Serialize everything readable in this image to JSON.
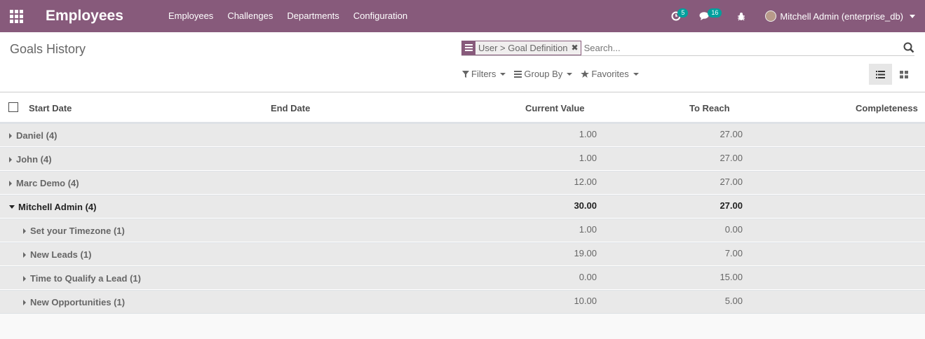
{
  "navbar": {
    "app_title": "Employees",
    "menu": [
      "Employees",
      "Challenges",
      "Departments",
      "Configuration"
    ],
    "activity_count": "5",
    "message_count": "16",
    "user": "Mitchell Admin (enterprise_db)"
  },
  "control_panel": {
    "title": "Goals History",
    "facet": "User > Goal Definition",
    "search_placeholder": "Search...",
    "filters_label": "Filters",
    "groupby_label": "Group By",
    "favorites_label": "Favorites"
  },
  "table": {
    "headers": {
      "start_date": "Start Date",
      "end_date": "End Date",
      "current_value": "Current Value",
      "to_reach": "To Reach",
      "completeness": "Completeness"
    },
    "groups": [
      {
        "label": "Daniel (4)",
        "current": "1.00",
        "reach": "27.00"
      },
      {
        "label": "John (4)",
        "current": "1.00",
        "reach": "27.00"
      },
      {
        "label": "Marc Demo (4)",
        "current": "12.00",
        "reach": "27.00"
      },
      {
        "label": "Mitchell Admin (4)",
        "current": "30.00",
        "reach": "27.00"
      }
    ],
    "subgroups": [
      {
        "label": "Set your Timezone (1)",
        "current": "1.00",
        "reach": "0.00"
      },
      {
        "label": "New Leads (1)",
        "current": "19.00",
        "reach": "7.00"
      },
      {
        "label": "Time to Qualify a Lead (1)",
        "current": "0.00",
        "reach": "15.00"
      },
      {
        "label": "New Opportunities (1)",
        "current": "10.00",
        "reach": "5.00"
      }
    ]
  },
  "colors": {
    "brand": "#875a7b",
    "badge": "#00a09d"
  }
}
